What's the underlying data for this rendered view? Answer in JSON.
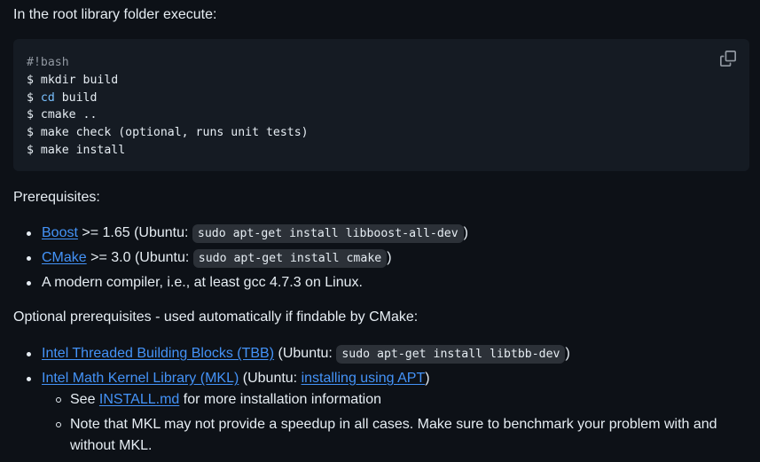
{
  "intro_text": "In the root library folder execute:",
  "code_block": {
    "lines": [
      {
        "type": "comment",
        "text": "#!bash"
      },
      {
        "prompt": "$ ",
        "text": "mkdir build"
      },
      {
        "prompt": "$ ",
        "builtin": "cd",
        "text": " build"
      },
      {
        "prompt": "$ ",
        "text": "cmake .."
      },
      {
        "prompt": "$ ",
        "text": "make check (optional, runs unit tests)"
      },
      {
        "prompt": "$ ",
        "text": "make install"
      }
    ],
    "copy_icon": "copy-icon"
  },
  "prerequisites": {
    "heading": "Prerequisites:",
    "items": [
      {
        "link": "Boost",
        "mid": " >= 1.65 (Ubuntu: ",
        "code": "sudo apt-get install libboost-all-dev",
        "end": ")"
      },
      {
        "link": "CMake",
        "mid": " >= 3.0 (Ubuntu: ",
        "code": "sudo apt-get install cmake",
        "end": ")"
      },
      {
        "text": "A modern compiler, i.e., at least gcc 4.7.3 on Linux."
      }
    ]
  },
  "optional": {
    "heading": "Optional prerequisites - used automatically if findable by CMake:",
    "items": [
      {
        "link": "Intel Threaded Building Blocks (TBB)",
        "mid": " (Ubuntu: ",
        "code": "sudo apt-get install libtbb-dev",
        "end": ")"
      },
      {
        "link": "Intel Math Kernel Library (MKL)",
        "mid": " (Ubuntu: ",
        "link2": "installing using APT",
        "end": ")"
      }
    ],
    "sub_items": [
      {
        "pre": "See ",
        "link": "INSTALL.md",
        "post": " for more installation information"
      },
      {
        "text": "Note that MKL may not provide a speedup in all cases. Make sure to benchmark your problem with and without MKL."
      }
    ]
  },
  "colors": {
    "background": "#0d1117",
    "code_bg": "#151b23",
    "link": "#4493f8",
    "text": "#e6edf3"
  }
}
